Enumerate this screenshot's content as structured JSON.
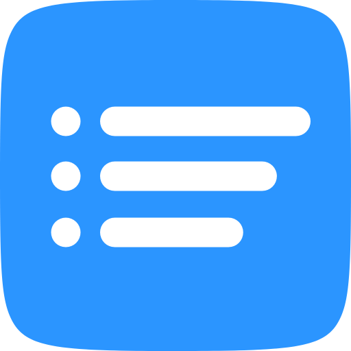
{
  "icon": {
    "name": "bulleted-list-icon",
    "background_color": "#2b95ff",
    "foreground_color": "#ffffff",
    "rows": [
      {
        "name": "list-row-1",
        "bar_length": 1.0
      },
      {
        "name": "list-row-2",
        "bar_length": 0.84
      },
      {
        "name": "list-row-3",
        "bar_length": 0.68
      }
    ]
  }
}
